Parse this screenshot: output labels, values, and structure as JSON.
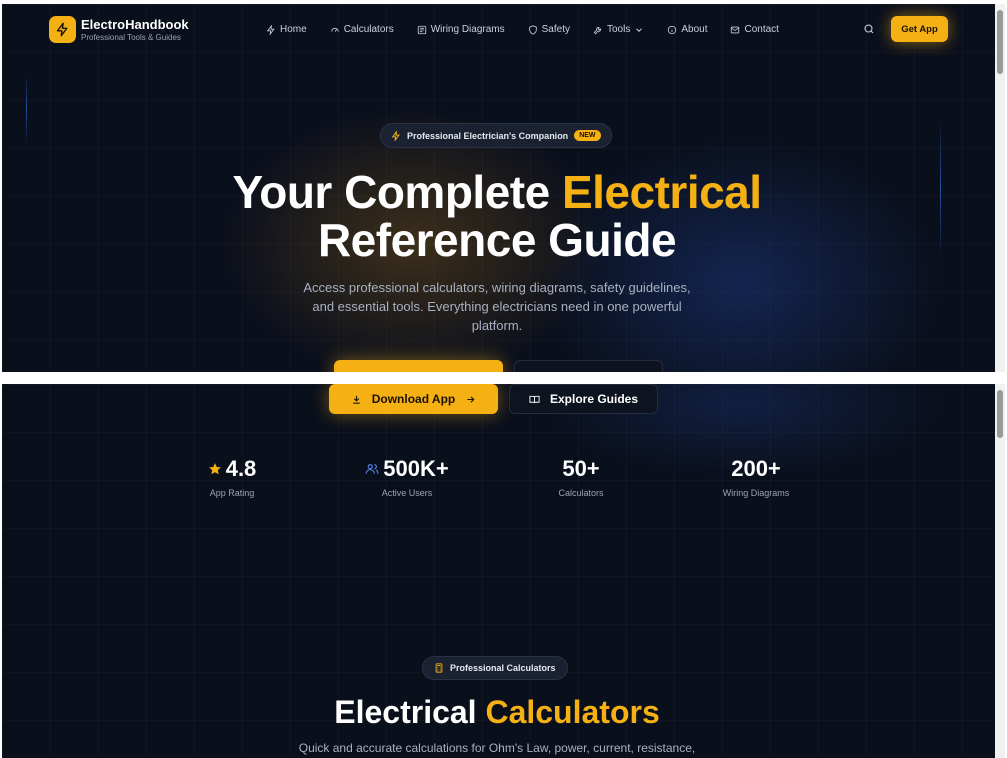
{
  "brand": {
    "name": "ElectroHandbook",
    "tagline": "Professional Tools & Guides"
  },
  "nav": {
    "items": [
      {
        "label": "Home",
        "icon": "bolt-icon"
      },
      {
        "label": "Calculators",
        "icon": "gauge-icon"
      },
      {
        "label": "Wiring Diagrams",
        "icon": "diagram-icon"
      },
      {
        "label": "Safety",
        "icon": "shield-icon"
      },
      {
        "label": "Tools",
        "icon": "wrench-icon"
      },
      {
        "label": "About",
        "icon": "info-icon"
      },
      {
        "label": "Contact",
        "icon": "mail-icon"
      }
    ],
    "get_app": "Get App"
  },
  "hero": {
    "badge": "Professional Electrician's Companion",
    "badge_new": "NEW",
    "title_plain": "Your Complete",
    "title_accent": "Electrical",
    "title_line2": "Reference Guide",
    "subtitle_line1": "Access professional calculators, wiring diagrams, safety guidelines,",
    "subtitle_line2": "and essential tools. Everything electricians need in one powerful",
    "subtitle_line3": "platform.",
    "download_label": "Download App",
    "explore_label": "Explore Guides"
  },
  "stats": [
    {
      "value": "4.8",
      "label": "App Rating",
      "icon": "star-icon"
    },
    {
      "value": "500K+",
      "label": "Active Users",
      "icon": "users-icon"
    },
    {
      "value": "50+",
      "label": "Calculators"
    },
    {
      "value": "200+",
      "label": "Wiring Diagrams"
    }
  ],
  "calculators": {
    "badge": "Professional Calculators",
    "title_plain": "Electrical",
    "title_accent": "Calculators",
    "subtitle": "Quick and accurate calculations for Ohm's Law, power, current, resistance,"
  },
  "colors": {
    "accent": "#f5b014",
    "background": "#0a0f1c",
    "surface": "#1a2131"
  }
}
